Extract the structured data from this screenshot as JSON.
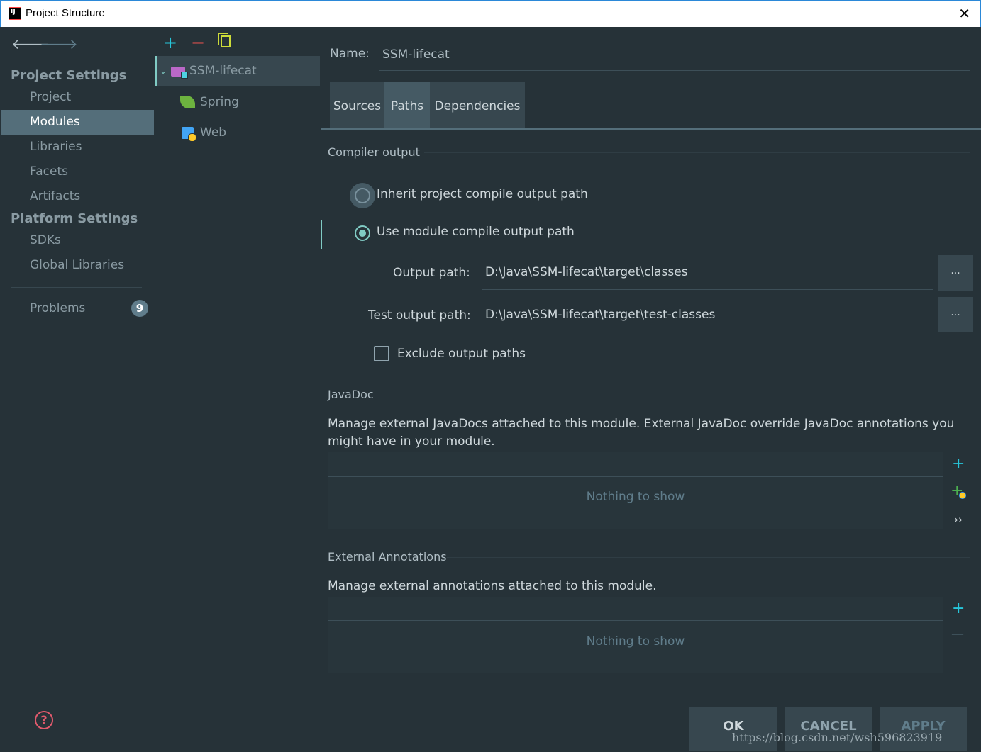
{
  "window": {
    "title": "Project Structure",
    "close_glyph": "✕"
  },
  "sidebar": {
    "back_icon": "arrow-left-icon",
    "forward_icon": "arrow-right-icon",
    "project_settings_title": "Project Settings",
    "project_items": [
      {
        "label": "Project",
        "active": false
      },
      {
        "label": "Modules",
        "active": true
      },
      {
        "label": "Libraries",
        "active": false
      },
      {
        "label": "Facets",
        "active": false
      },
      {
        "label": "Artifacts",
        "active": false
      }
    ],
    "platform_settings_title": "Platform Settings",
    "platform_items": [
      {
        "label": "SDKs"
      },
      {
        "label": "Global Libraries"
      }
    ],
    "problems_label": "Problems",
    "problems_count": "9",
    "help_glyph": "?"
  },
  "module_tree": {
    "add_glyph": "+",
    "remove_glyph": "−",
    "root": {
      "label": "SSM-lifecat",
      "chevron": "✓"
    },
    "children": [
      {
        "label": "Spring"
      },
      {
        "label": "Web"
      }
    ]
  },
  "details": {
    "name_label": "Name:",
    "name_value": "SSM-lifecat",
    "tabs": [
      {
        "label": "Sources",
        "active": false
      },
      {
        "label": "Paths",
        "active": true
      },
      {
        "label": "Dependencies",
        "active": false
      }
    ],
    "compiler_output": {
      "title": "Compiler output",
      "inherit_label": "Inherit project compile output path",
      "inherit_checked": false,
      "use_module_label": "Use module compile output path",
      "use_module_checked": true,
      "output_path_label": "Output path:",
      "output_path_value": "D:\\Java\\SSM-lifecat\\target\\classes",
      "test_output_path_label": "Test output path:",
      "test_output_path_value": "D:\\Java\\SSM-lifecat\\target\\test-classes",
      "browse_label": "...",
      "exclude_label": "Exclude output paths",
      "exclude_checked": false
    },
    "javadoc": {
      "title": "JavaDoc",
      "description_line1": "Manage external JavaDocs attached to this module. External JavaDoc override JavaDoc annotations you",
      "description_line2": "might have in your module.",
      "empty_text": "Nothing to show",
      "add_glyph": "+",
      "more_glyph": "››"
    },
    "external_annotations": {
      "title": "External Annotations",
      "description": "Manage external annotations attached to this module.",
      "empty_text": "Nothing to show",
      "add_glyph": "+",
      "remove_glyph": "—"
    }
  },
  "footer": {
    "ok_label": "OK",
    "cancel_label": "CANCEL",
    "apply_label": "APPLY"
  },
  "watermark": "https://blog.csdn.net/wsh596823919",
  "colors": {
    "background": "#263238",
    "selection": "#546e7a",
    "accent": "#80cbc4",
    "add": "#26c6da",
    "remove": "#ef5350",
    "badge": "#607d8b"
  }
}
